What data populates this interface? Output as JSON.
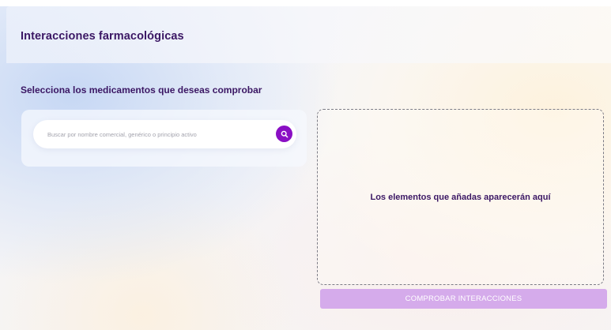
{
  "header": {
    "title": "Interacciones farmacológicas"
  },
  "section": {
    "title": "Selecciona los medicamentos que deseas comprobar"
  },
  "search": {
    "value": "",
    "placeholder": "Buscar por nombre comercial, genérico o principio activo",
    "button_icon": "search-icon"
  },
  "selection": {
    "empty_message": "Los elementos que añadas aparecerán aquí"
  },
  "actions": {
    "check_label": "COMPROBAR INTERACCIONES",
    "check_enabled": false
  },
  "colors": {
    "accent": "#8a0fc4",
    "title": "#3b1764",
    "button_disabled": "#d5abeb"
  }
}
